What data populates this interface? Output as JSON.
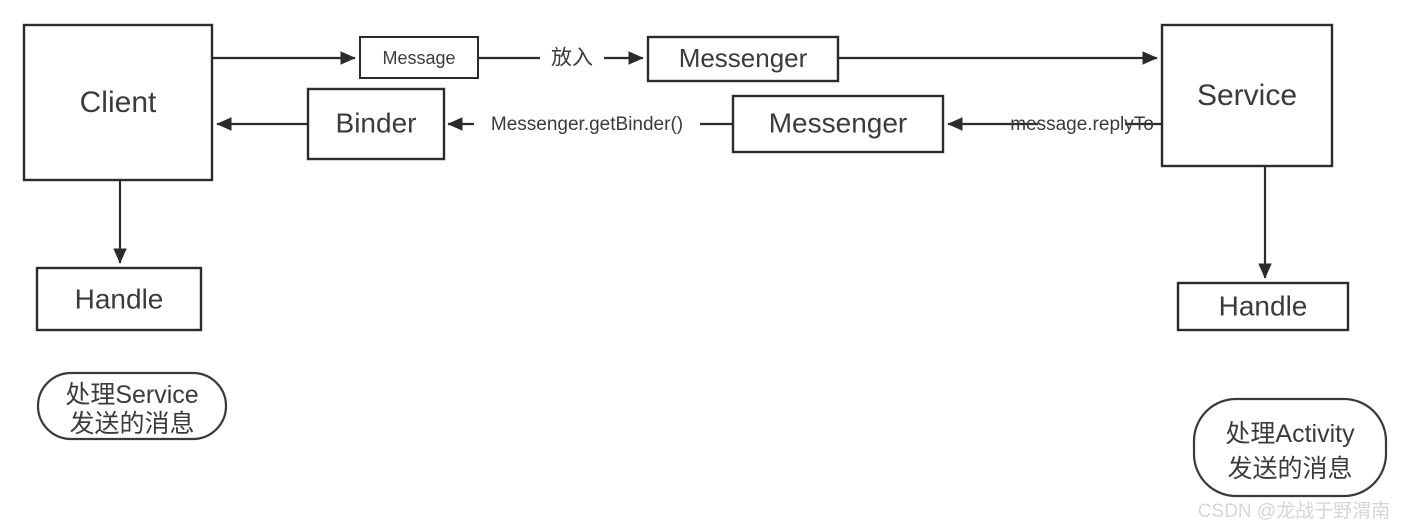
{
  "diagram": {
    "title": "Android Messenger IPC flow",
    "colors": {
      "stroke": "#2b2b2b",
      "text": "#3b3b3b",
      "background": "#ffffff",
      "watermark": "#d6d6d6"
    },
    "nodes": {
      "client": "Client",
      "message": "Message",
      "binder": "Binder",
      "messenger_top": "Messenger",
      "messenger_bottom": "Messenger",
      "service": "Service",
      "handle_left": "Handle",
      "handle_right": "Handle"
    },
    "edge_labels": {
      "put_in": "放入",
      "get_binder": "Messenger.getBinder()",
      "reply_to": "message.replyTo"
    },
    "notes": {
      "left_line1": "处理Service",
      "left_line2": "发送的消息",
      "right_line1": "处理Activity",
      "right_line2": "发送的消息"
    },
    "watermark": "CSDN @龙战于野渭南"
  }
}
